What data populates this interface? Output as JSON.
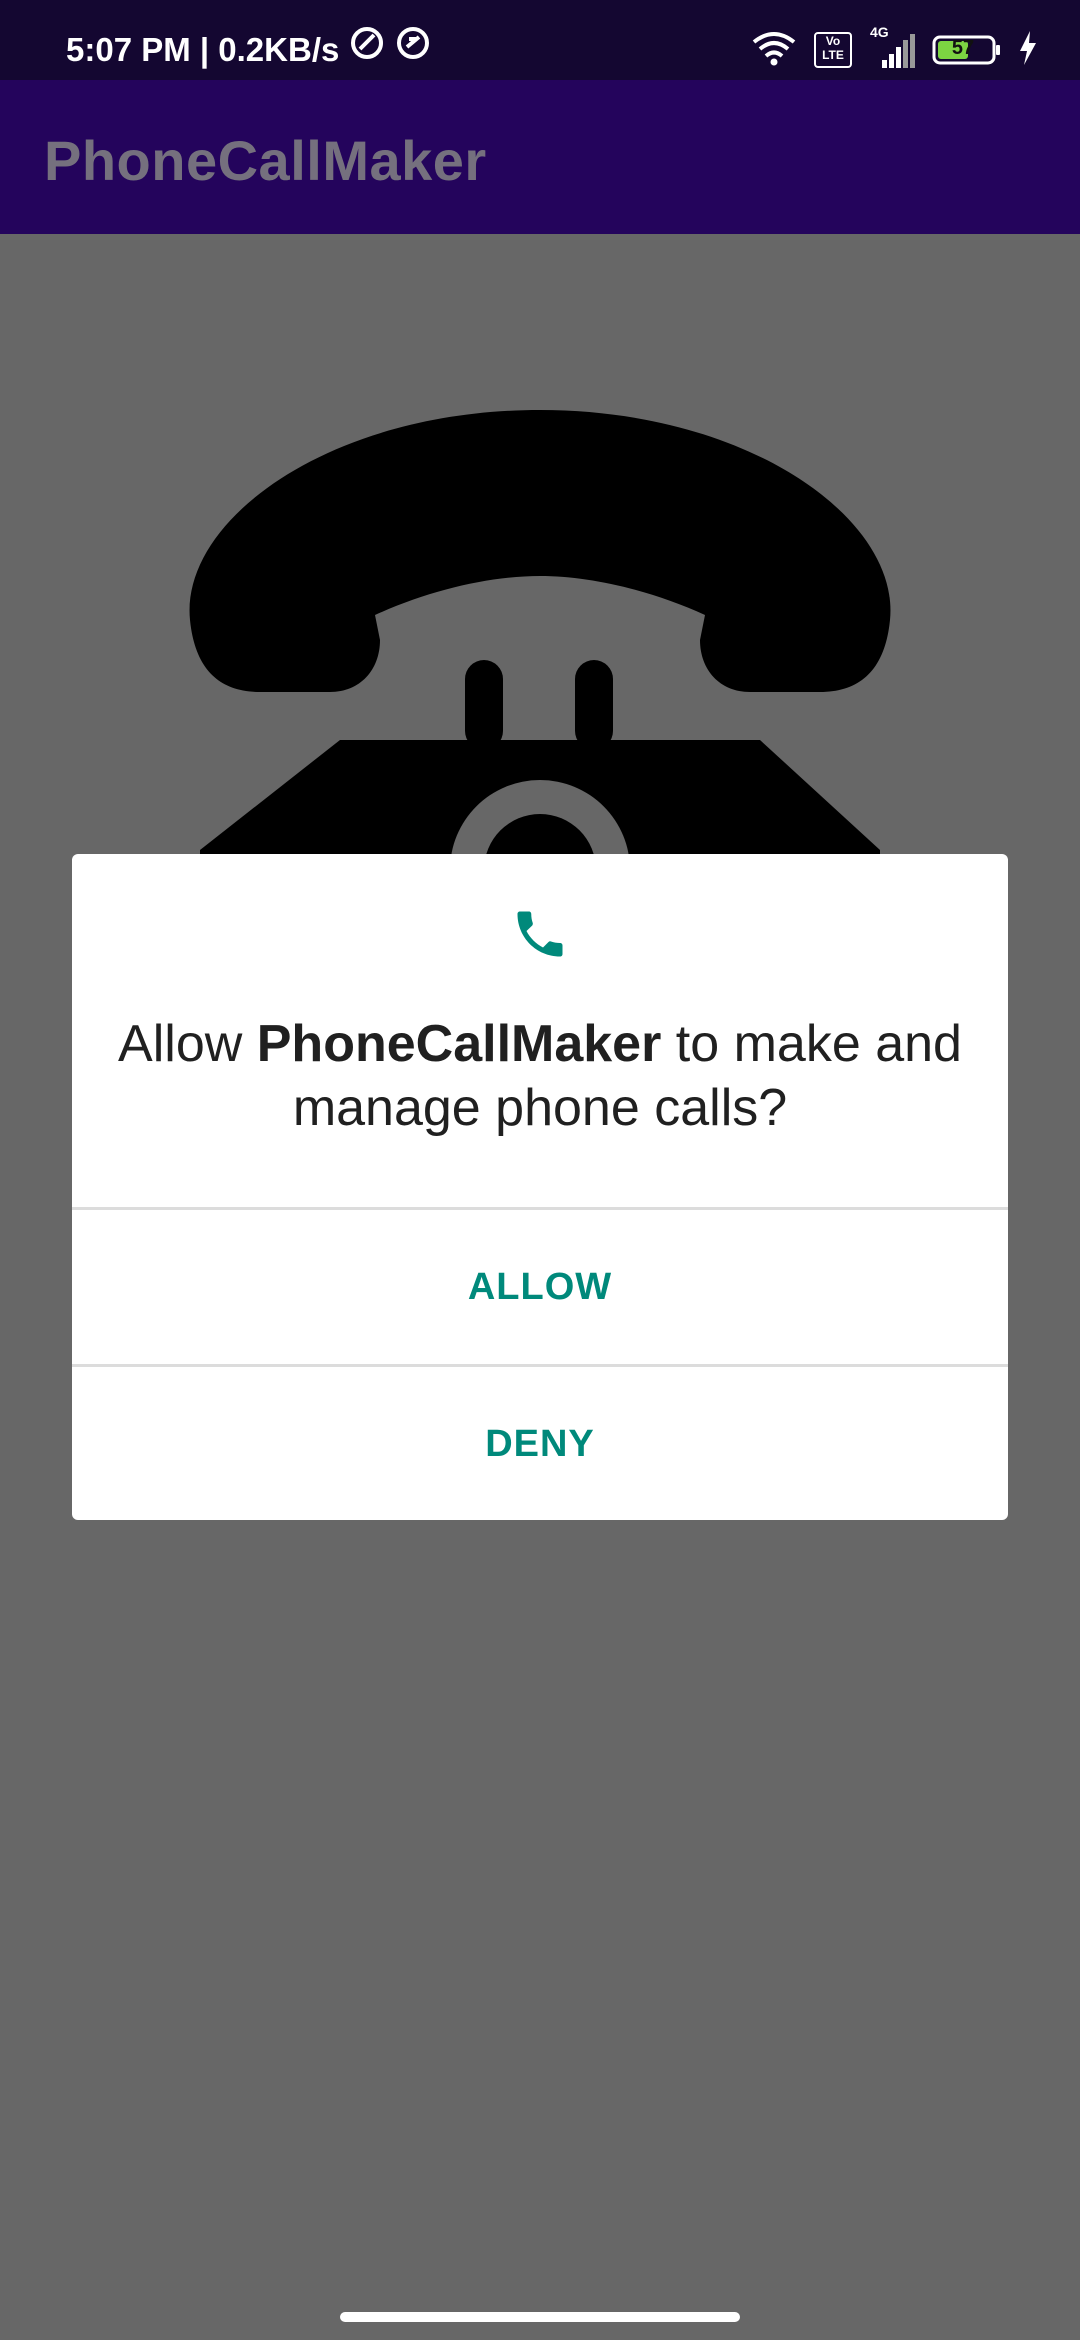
{
  "status_bar": {
    "time_speed": "5:07 PM | 0.2KB/s",
    "network": "4G",
    "volte": "Vo LTE",
    "battery": "57"
  },
  "app_bar": {
    "title": "PhoneCallMaker"
  },
  "dialog": {
    "icon": "phone-icon",
    "message_prefix": "Allow ",
    "message_app": "PhoneCallMaker",
    "message_suffix": " to make and manage phone calls?",
    "allow_label": "ALLOW",
    "deny_label": "DENY"
  },
  "colors": {
    "accent": "#00897b",
    "app_bar": "#24045c",
    "status_bar": "#140731",
    "scrim": "#676767"
  }
}
